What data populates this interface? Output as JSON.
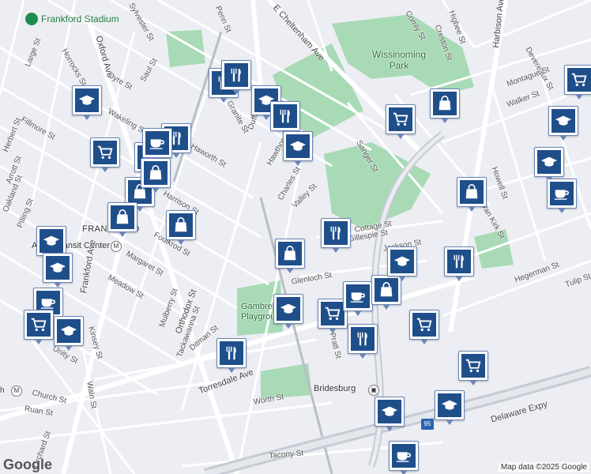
{
  "map": {
    "poi_label": "Frankford Stadium",
    "park_label": "Wissinoming Park",
    "areas": [
      "FRANKFORD"
    ],
    "stations": [
      "Arrott Transit Center",
      "Bridesburg",
      "Church"
    ],
    "parks": [
      "Gambrel Playground"
    ],
    "streets": [
      "E Cheltenham Ave",
      "Oxford Ave",
      "Large St",
      "Horrocks St",
      "Dyre St",
      "Saul St",
      "Penn St",
      "Wakeling St",
      "Fillmore St",
      "Haworth St",
      "Harrison St",
      "Foulkrod St",
      "Margaret St",
      "Meadow St",
      "Frankford Ave",
      "Orthodox St",
      "Torresdale Ave",
      "Mulberry St",
      "Tackawanna St",
      "Ditman St",
      "Kinsey St",
      "Unity St",
      "Church St",
      "Ruan St",
      "Worth St",
      "Waln St",
      "Pratt St",
      "Duffield St",
      "Hawthorne St",
      "Charles St",
      "Valley St",
      "Sanger St",
      "Glenloch St",
      "Gillespie St",
      "Cottage St",
      "Jackson St",
      "Harbison Ave",
      "Comly St",
      "Higbee St",
      "Creston St",
      "Devereaux St",
      "Montague St",
      "Walker St",
      "Van Kirk St",
      "Howell St",
      "Hegerman St",
      "Tulip St",
      "Delaware Expy",
      "Tacony St",
      "Pilling St",
      "Oakland St",
      "Orchard St",
      "Granite St",
      "Arrott St",
      "Herbert St",
      "Sylvester St"
    ],
    "highway_shield": "95",
    "logo": "Google",
    "attribution": "Map data ©2025 Google"
  },
  "icons": {
    "graduation": "graduation-cap-icon",
    "fork": "fork-knife-icon",
    "cart": "shopping-cart-icon",
    "bag": "shopping-bag-icon",
    "cup": "coffee-cup-icon"
  },
  "colors": {
    "pin": "#1f4f8a",
    "park": "#a8dab5",
    "road": "#ffffff",
    "highway": "#c6cbd3",
    "rail": "#b9bec7"
  }
}
